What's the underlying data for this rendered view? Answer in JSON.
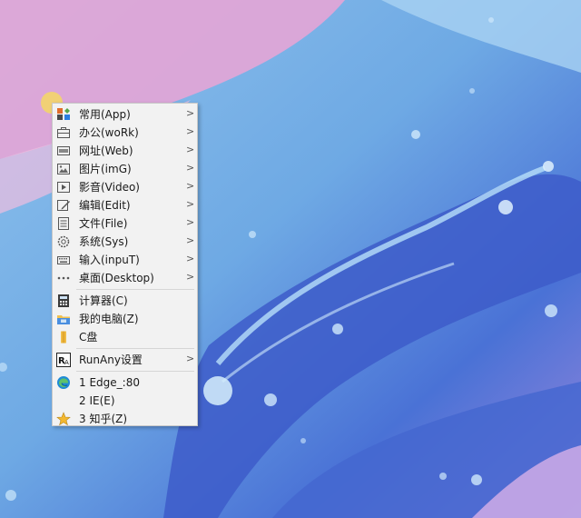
{
  "menu": {
    "groups": [
      [
        {
          "label": "常用(App)",
          "icon": "grid-apps-icon",
          "submenu": true
        },
        {
          "label": "办公(woRk)",
          "icon": "briefcase-icon",
          "submenu": true
        },
        {
          "label": "网址(Web)",
          "icon": "web-window-icon",
          "submenu": true
        },
        {
          "label": "图片(imG)",
          "icon": "image-icon",
          "submenu": true
        },
        {
          "label": "影音(Video)",
          "icon": "video-icon",
          "submenu": true
        },
        {
          "label": "编辑(Edit)",
          "icon": "edit-pencil-icon",
          "submenu": true
        },
        {
          "label": "文件(File)",
          "icon": "file-icon",
          "submenu": true
        },
        {
          "label": "系统(Sys)",
          "icon": "gear-icon",
          "submenu": true
        },
        {
          "label": "输入(inpuT)",
          "icon": "keyboard-icon",
          "submenu": true
        },
        {
          "label": "桌面(Desktop)",
          "icon": "dots-icon",
          "submenu": true
        }
      ],
      [
        {
          "label": "计算器(C)",
          "icon": "calculator-icon",
          "submenu": false
        },
        {
          "label": "我的电脑(Z)",
          "icon": "computer-folder-icon",
          "submenu": false
        },
        {
          "label": "C盘",
          "icon": "folder-icon",
          "submenu": false
        }
      ],
      [
        {
          "label": "RunAny设置",
          "icon": "runany-logo-icon",
          "submenu": true
        }
      ],
      [
        {
          "label": "1 Edge_:80",
          "icon": "edge-icon",
          "submenu": false
        },
        {
          "label": "2 IE(E)",
          "icon": "",
          "submenu": false
        },
        {
          "label": "3 知乎(Z)",
          "icon": "star-icon",
          "submenu": false
        }
      ]
    ],
    "submenu_arrow": ">"
  }
}
